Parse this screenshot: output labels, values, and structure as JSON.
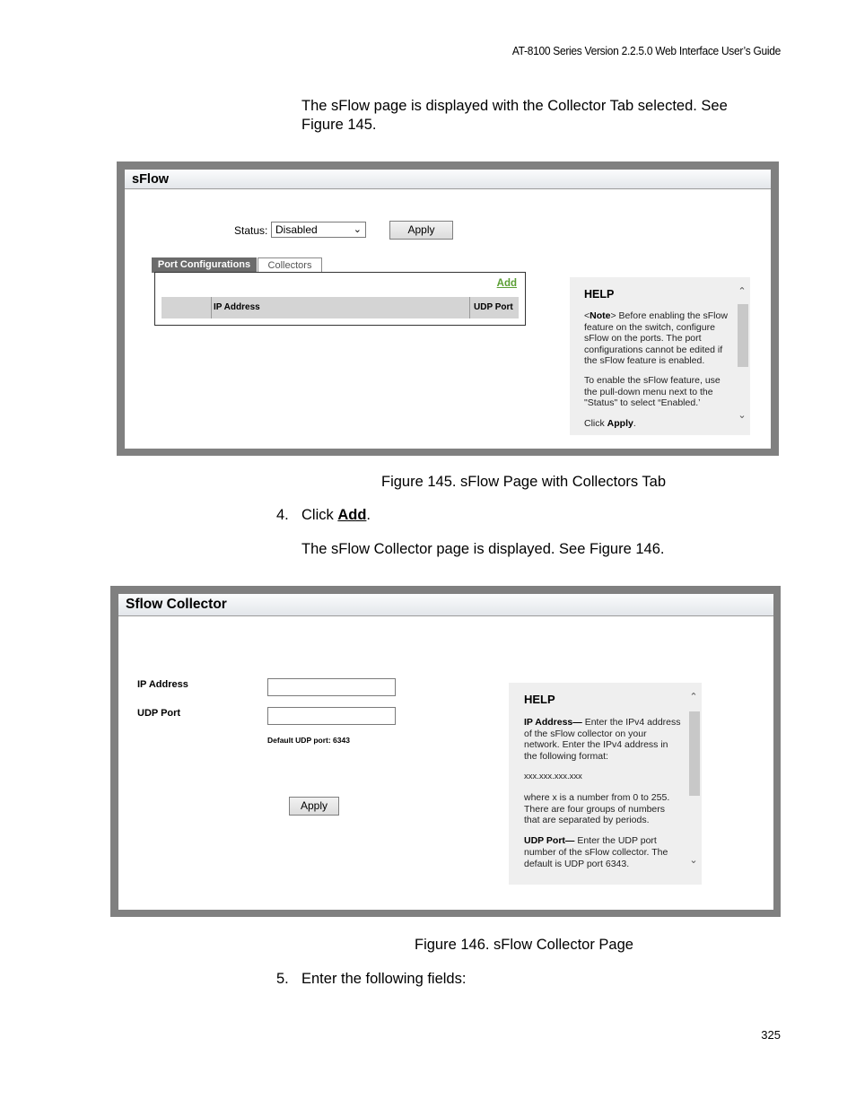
{
  "page": {
    "running_header": "AT-8100 Series Version 2.2.5.0 Web Interface User’s Guide",
    "intro_text": "The sFlow page is displayed with the Collector Tab selected. See Figure 145.",
    "figure145_caption": "Figure 145. sFlow Page with Collectors Tab",
    "step4_number": "4.",
    "step4_prefix": "Click ",
    "step4_link": "Add",
    "step4_suffix": ".",
    "step4_followup": "The sFlow Collector page is displayed. See Figure 146.",
    "figure146_caption": "Figure 146. sFlow Collector Page",
    "step5_number": "5.",
    "step5_text": "Enter the following fields:",
    "page_number": "325"
  },
  "sflow_page": {
    "title": "sFlow",
    "status_label": "Status:",
    "status_value": "Disabled",
    "apply_label": "Apply",
    "tabs": [
      {
        "label": "Port Configurations",
        "active": false
      },
      {
        "label": "Collectors",
        "active": true
      }
    ],
    "add_label": "Add",
    "table_columns": [
      "",
      "IP Address",
      "UDP Port"
    ],
    "help": {
      "title": "HELP",
      "note_prefix": "<",
      "note_bold": "Note",
      "note_text": "> Before enabling the sFlow feature on the switch, configure sFlow on the ports. The port configurations cannot be edited if the sFlow feature is enabled.",
      "para2": "To enable the sFlow feature, use the pull-down menu next to the \"Status\" to select “Enabled.’",
      "click_prefix": "Click ",
      "click_bold": "Apply",
      "click_suffix": "."
    }
  },
  "collector_page": {
    "title": "Sflow Collector",
    "ip_label": "IP Address",
    "ip_value": "",
    "udp_label": "UDP Port",
    "udp_value": "",
    "udp_hint": "Default UDP port: 6343",
    "apply_label": "Apply",
    "help": {
      "title": "HELP",
      "ip_bold": "IP Address—",
      "ip_text": " Enter the IPv4 address of the sFlow collector on your network. Enter the IPv4 address in the following format:",
      "format": "xxx.xxx.xxx.xxx",
      "range_text": "where x is a number from 0 to 255. There are four groups of numbers that are separated by periods.",
      "udp_bold": "UDP Port—",
      "udp_text": " Enter the UDP port number of the sFlow collector. The default is UDP port 6343."
    }
  },
  "colors": {
    "frame_gray": "#808080",
    "active_tab": "#6b6b6b",
    "add_link_green": "#5a9e33",
    "help_bg": "#efefef"
  }
}
